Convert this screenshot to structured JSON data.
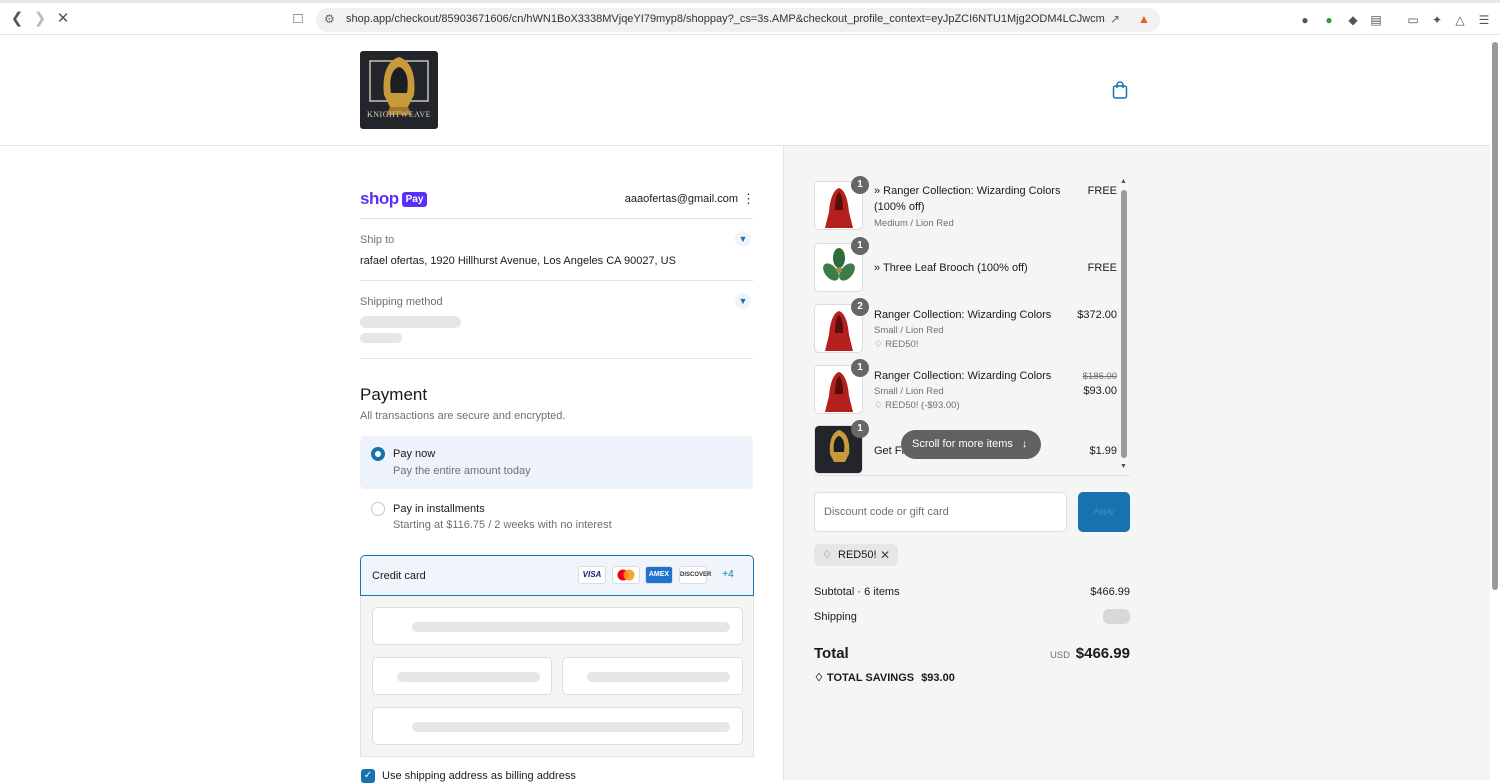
{
  "browser": {
    "url": "shop.app/checkout/85903671606/cn/hWN1BoX3338MVjqeYI79myp8/shoppay?_cs=3s.AMP&checkout_profile_context=eyJpZCI6NTU1Mjg2ODM4LCJwcm..."
  },
  "store": {
    "logo_text": "KNIGHTWEAVE"
  },
  "account": {
    "brand_word": "shop",
    "brand_pay": "Pay",
    "email": "aaaofertas@gmail.com"
  },
  "ship_to": {
    "label": "Ship to",
    "address": "rafael ofertas, 1920 Hillhurst Avenue, Los Angeles CA 90027, US"
  },
  "shipping_method": {
    "label": "Shipping method"
  },
  "payment": {
    "title": "Payment",
    "subtitle": "All transactions are secure and encrypted.",
    "pay_now_title": "Pay now",
    "pay_now_sub": "Pay the entire amount today",
    "installments_title": "Pay in installments",
    "installments_sub": "Starting at $116.75 / 2 weeks with no interest",
    "credit_card_label": "Credit card",
    "cards": [
      "VISA",
      "MC",
      "AMEX",
      "DISCOVER"
    ],
    "more_cards": "+4",
    "billing_same": "Use shipping address as billing address"
  },
  "items": [
    {
      "qty": "1",
      "name_line1": "» Ranger Collection: Wizarding Colors",
      "name_line2": "(100% off)",
      "variant": "Medium / Lion Red",
      "price": "FREE"
    },
    {
      "qty": "1",
      "name_line1": "» Three Leaf Brooch (100% off)",
      "price": "FREE"
    },
    {
      "qty": "2",
      "name_line1": "Ranger Collection: Wizarding Colors",
      "variant": "Small / Lion Red",
      "discount": "RED50!",
      "price": "$372.00"
    },
    {
      "qty": "1",
      "name_line1": "Ranger Collection: Wizarding Colors",
      "variant": "Small / Lion Red",
      "discount": "RED50! (-$93.00)",
      "original_price": "$186.00",
      "price": "$93.00"
    },
    {
      "qty": "1",
      "name_line1": "Get Fr",
      "price": "$1.99"
    }
  ],
  "scroll_hint": "Scroll for more items",
  "discount": {
    "placeholder": "Discount code or gift card",
    "apply_label": "Apply",
    "applied_code": "RED50!"
  },
  "summary": {
    "subtotal_label": "Subtotal · 6 items",
    "subtotal_value": "$466.99",
    "shipping_label": "Shipping",
    "total_label": "Total",
    "currency": "USD",
    "total_value": "$466.99",
    "savings_label": "TOTAL SAVINGS",
    "savings_value": "$93.00"
  },
  "colors": {
    "accent": "#1773b0",
    "shop_pay": "#5a31f4"
  }
}
